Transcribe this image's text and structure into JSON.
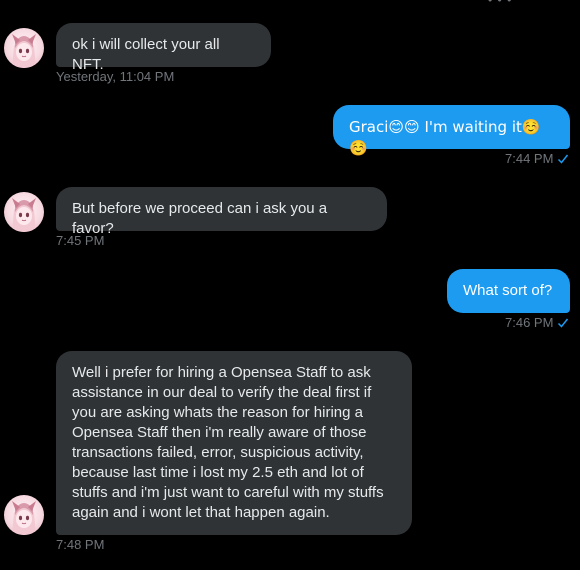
{
  "messages": [
    {
      "text": "ok i will collect your all NFT.",
      "time": "Yesterday, 11:04 PM"
    },
    {
      "text": "Graci😊😊 I'm waiting it☺️☺️",
      "time": "7:44 PM"
    },
    {
      "text": "But before we proceed can i ask you a favor?",
      "time": "7:45 PM"
    },
    {
      "text": "What sort of?",
      "time": "7:46 PM"
    },
    {
      "text": "Well i prefer for hiring a Opensea Staff to ask assistance in our deal to verify the deal first if you are asking whats the reason for hiring a Opensea Staff then i'm really aware of those transactions failed, error, suspicious activity, because last time i lost my 2.5 eth and lot of stuffs and  i'm just want to careful with my stuffs again and i wont let that happen again.",
      "time": "7:48 PM"
    }
  ],
  "colors": {
    "background": "#000000",
    "incoming_bubble": "#2f3336",
    "outgoing_bubble": "#1d9bf0",
    "meta_text": "#71767b",
    "seen_check": "#1d9bf0"
  }
}
